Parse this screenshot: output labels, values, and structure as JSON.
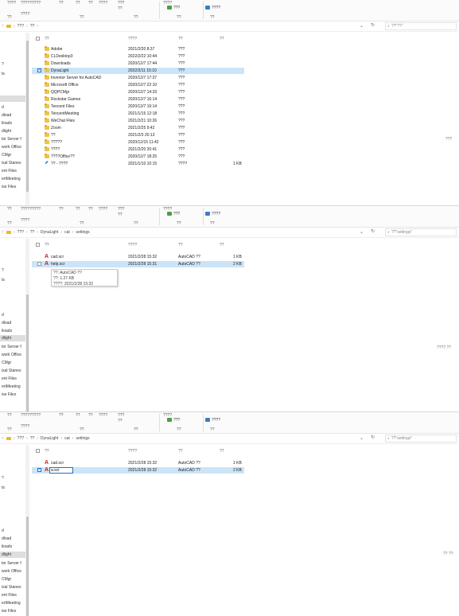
{
  "panels": [
    {
      "ribbon": {
        "fragments": [
          "????",
          "?????????",
          "??",
          "??",
          "??",
          "????",
          "???",
          "??",
          "????",
          "????",
          "??"
        ],
        "properties_btn": "???",
        "select_all_btn": "????",
        "group_open": "??",
        "group_select": "??"
      },
      "address": {
        "crumbs": [
          "???",
          "??"
        ],
        "search_placeholder": "??\"??\""
      },
      "columns": {
        "name": "??",
        "date": "????",
        "type": "??",
        "size": "??"
      },
      "nav_items": [
        "?",
        "?",
        "ts",
        "d",
        "dload",
        "lioads",
        "dlight",
        "tor Server f",
        "work Office",
        "CMgr",
        "ixal Stanes",
        "ent Files",
        "ertMeeting",
        "ise Files"
      ],
      "rows": [
        {
          "name": "Adobe",
          "date": "2021/2/20 8:37",
          "type": "???",
          "size": "",
          "icon": "folder-icon"
        },
        {
          "name": "CLDesktop3",
          "date": "2022/2/22 10:44",
          "type": "???",
          "size": "",
          "icon": "folder-icon"
        },
        {
          "name": "Downloads",
          "date": "2020/12/7 17:44",
          "type": "???",
          "size": "",
          "icon": "folder-icon"
        },
        {
          "name": "DynaLight",
          "date": "2022/2/11 15:10",
          "type": "???",
          "size": "",
          "icon": "folder-icon"
        },
        {
          "name": "Inventor Server for AutoCAD",
          "date": "2020/12/7 17:37",
          "type": "???",
          "size": "",
          "icon": "folder-icon"
        },
        {
          "name": "Microsoft Office",
          "date": "2020/12/7 22:10",
          "type": "???",
          "size": "",
          "icon": "folder-icon"
        },
        {
          "name": "QQPCMgr",
          "date": "2020/12/7 14:33",
          "type": "???",
          "size": "",
          "icon": "folder-icon"
        },
        {
          "name": "Rockstar Games",
          "date": "2020/12/7 16:14",
          "type": "???",
          "size": "",
          "icon": "folder-icon"
        },
        {
          "name": "Tencent Files",
          "date": "2020/12/7 19:14",
          "type": "???",
          "size": "",
          "icon": "folder-icon"
        },
        {
          "name": "TencentMeeting",
          "date": "2021/1/15 12:18",
          "type": "???",
          "size": "",
          "icon": "folder-icon"
        },
        {
          "name": "WeChat Files",
          "date": "2021/2/21 10:26",
          "type": "???",
          "size": "",
          "icon": "folder-icon"
        },
        {
          "name": "Zoom",
          "date": "2021/2/25 9:42",
          "type": "???",
          "size": "",
          "icon": "folder-icon"
        },
        {
          "name": "??",
          "date": "2021/2/3 20:13",
          "type": "???",
          "size": "",
          "icon": "folder-icon"
        },
        {
          "name": "?????",
          "date": "2020/12/15 11:42",
          "type": "???",
          "size": "",
          "icon": "folder-icon"
        },
        {
          "name": "????",
          "date": "2021/2/20 20:41",
          "type": "???",
          "size": "",
          "icon": "folder-icon"
        },
        {
          "name": "????Office??",
          "date": "2020/12/7 18:25",
          "type": "???",
          "size": "",
          "icon": "folder-icon"
        },
        {
          "name": "?? - ????",
          "date": "2021/1/10 10:15",
          "type": "????",
          "size": "1 KB",
          "icon": "shortcut-icon"
        }
      ],
      "status_right": "???"
    },
    {
      "ribbon": {
        "fragments": [
          "??",
          "?????????",
          "??",
          "??",
          "??",
          "????",
          "???",
          "??",
          "????",
          "????",
          "??"
        ],
        "properties_btn": "???",
        "select_all_btn": "????",
        "group_open": "??",
        "group_select": "??"
      },
      "address": {
        "crumbs": [
          "???",
          "??",
          "DynaLight",
          "cat",
          "settings"
        ],
        "search_placeholder": "??\"settings\""
      },
      "columns": {
        "name": "??",
        "date": "????",
        "type": "??",
        "size": "??"
      },
      "nav_items": [
        "?",
        "?",
        "ts",
        "d",
        "dload",
        "lioads",
        "dlight",
        "tor Server f",
        "work Office",
        "CMgr",
        "ixal Stanes",
        "ent Files",
        "ertMeeting",
        "ise Files"
      ],
      "rows": [
        {
          "name": "cad.scr",
          "date": "2021/2/28 15:32",
          "type": "AutoCAD ??",
          "size": "1 KB",
          "icon": "autocad-file-icon"
        },
        {
          "name": "help.scr",
          "date": "2021/2/28 15:31",
          "type": "AutoCAD ??",
          "size": "2 KB",
          "icon": "autocad-file-icon"
        }
      ],
      "tooltip": [
        "??: AutoCAD ??",
        "??: 1.27 KB",
        "????: 2021/2/28 15:32"
      ],
      "status_right": "???? ??"
    },
    {
      "ribbon": {
        "fragments": [
          "??",
          "?????????",
          "??",
          "??",
          "??",
          "????",
          "???",
          "??",
          "????",
          "????",
          "??"
        ],
        "properties_btn": "???",
        "select_all_btn": "????",
        "group_open": "??",
        "group_select": "??"
      },
      "address": {
        "crumbs": [
          "???",
          "??",
          "DynaLight",
          "cat",
          "settings"
        ],
        "search_placeholder": "??\"settings\""
      },
      "columns": {
        "name": "??",
        "date": "????",
        "type": "??",
        "size": "??"
      },
      "nav_items": [
        "?",
        "?",
        "ts",
        "d",
        "dload",
        "lioads",
        "dlight",
        "tor Server f",
        "work Office",
        "CMgr",
        "ixal Stanes",
        "ent Files",
        "ertMeeting",
        "ise Files"
      ],
      "rows": [
        {
          "name": "cad.scr",
          "date": "2021/2/28 15:32",
          "type": "AutoCAD ??",
          "size": "1 KB",
          "icon": "autocad-file-icon"
        },
        {
          "name": "",
          "date": "2021/2/28 15:32",
          "type": "AutoCAD ??",
          "size": "2 KB",
          "icon": "autocad-file-icon"
        }
      ],
      "rename_value": "a.scr",
      "status_right": "?? ??"
    }
  ],
  "colors": {
    "selection": "#cce4f7",
    "folder": "#efc24a",
    "acad": "#c0201e",
    "accent": "#1a73c7"
  }
}
